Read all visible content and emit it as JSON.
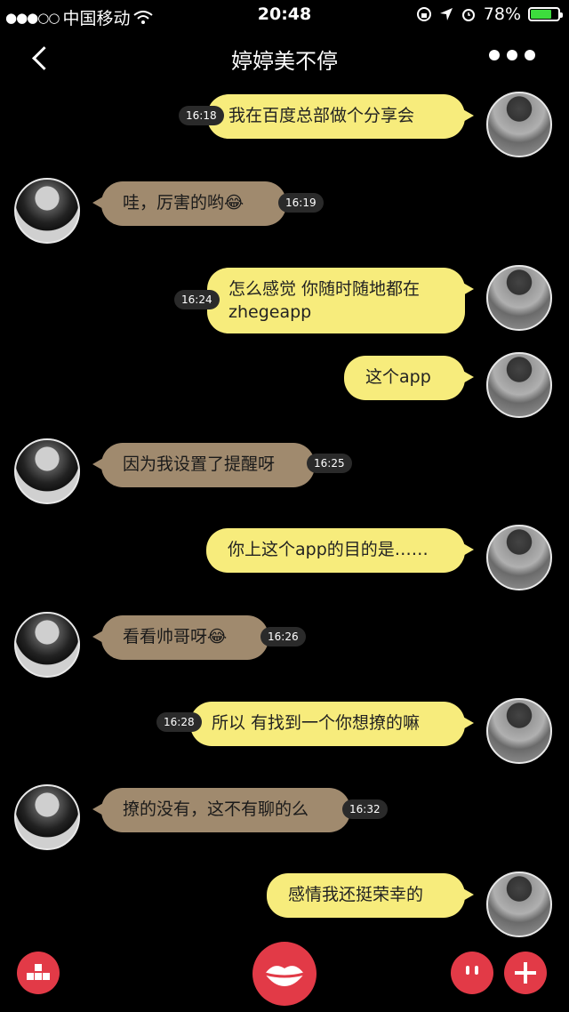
{
  "status_bar": {
    "carrier": "中国移动",
    "time": "20:48",
    "battery_percent": "78%",
    "battery_level": 0.78
  },
  "nav": {
    "title": "婷婷美不停"
  },
  "messages": [
    {
      "side": "right",
      "text": "我在百度总部做个分享会",
      "time": "16:18"
    },
    {
      "side": "left",
      "text": "哇，厉害的哟😂",
      "time": "16:19"
    },
    {
      "side": "right",
      "text": "怎么感觉 你随时随地都在\nzhegeapp",
      "time": "16:24"
    },
    {
      "side": "right",
      "text": "这个app",
      "time": ""
    },
    {
      "side": "left",
      "text": "因为我设置了提醒呀",
      "time": "16:25"
    },
    {
      "side": "right",
      "text": "你上这个app的目的是……",
      "time": ""
    },
    {
      "side": "left",
      "text": "看看帅哥呀😂",
      "time": "16:26"
    },
    {
      "side": "right",
      "text": "所以 有找到一个你想撩的嘛",
      "time": "16:28"
    },
    {
      "side": "left",
      "text": "撩的没有，这不有聊的么",
      "time": "16:32"
    },
    {
      "side": "right",
      "text": "感情我还挺荣幸的",
      "time": ""
    }
  ],
  "bottom_bar": {
    "icons": [
      "blocks-icon",
      "lips-icon",
      "face-icon",
      "plus-icon"
    ]
  },
  "colors": {
    "right_bubble": "#f7ec7c",
    "left_bubble": "#a08a6e",
    "accent": "#e23a47"
  }
}
